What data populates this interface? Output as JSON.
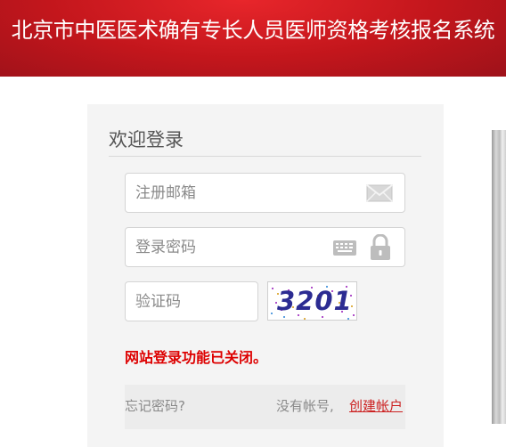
{
  "header": {
    "title": "北京市中医医术确有专长人员医师资格考核报名系统"
  },
  "login": {
    "title": "欢迎登录",
    "email_placeholder": "注册邮箱",
    "password_placeholder": "登录密码",
    "captcha_placeholder": "验证码",
    "captcha_text": "3201",
    "error_message": "网站登录功能已关闭。",
    "forgot_password": "忘记密码?",
    "no_account": "没有帐号,",
    "create_account": "创建帐户"
  },
  "icons": {
    "email": "envelope-icon",
    "keyboard": "keyboard-icon",
    "lock": "lock-icon"
  },
  "colors": {
    "header_red": "#c3161c",
    "error_red": "#dd0000",
    "link_red": "#cc2222",
    "panel_bg": "#f4f4f4"
  }
}
